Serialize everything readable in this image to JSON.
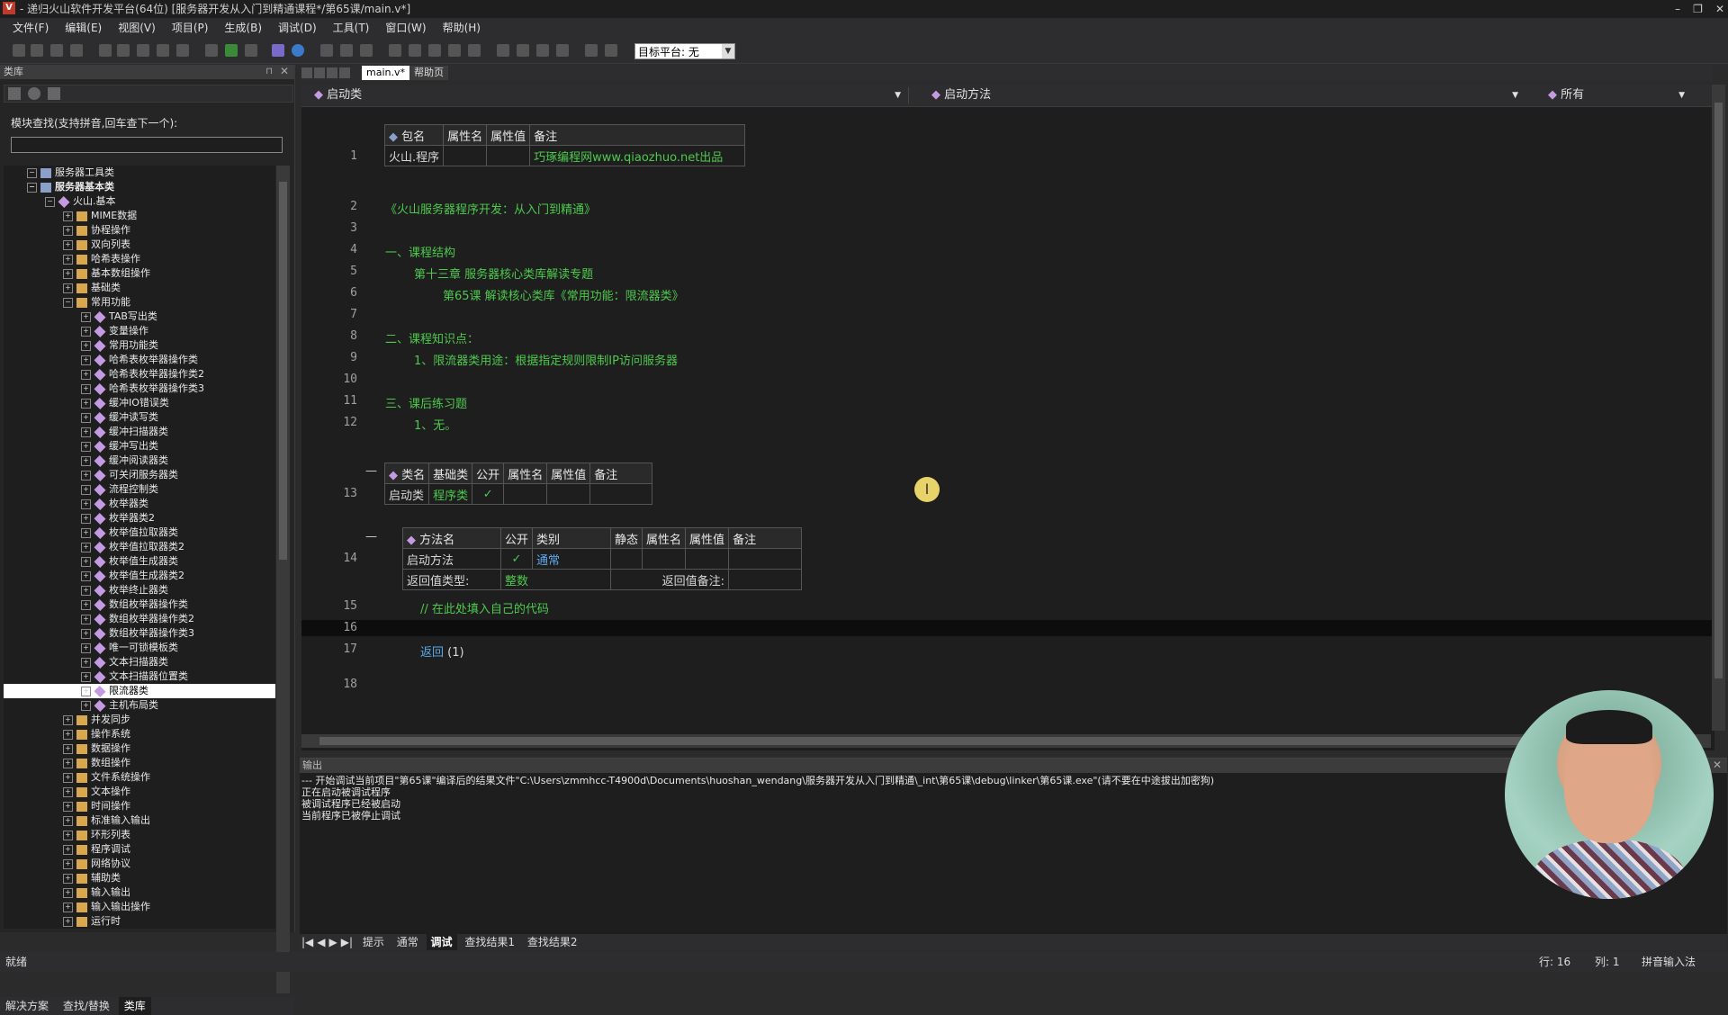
{
  "window": {
    "title": "- 递归火山软件开发平台(64位) [服务器开发从入门到精通课程*/第65课/main.v*]"
  },
  "menu": [
    "文件(F)",
    "编辑(E)",
    "视图(V)",
    "项目(P)",
    "生成(B)",
    "调试(D)",
    "工具(T)",
    "窗口(W)",
    "帮助(H)"
  ],
  "toolbar": {
    "target_label": "目标平台: 无"
  },
  "left_panel": {
    "title": "类库",
    "search_label": "模块查找(支持拼音,回车查下一个):",
    "search_value": "",
    "tree": [
      {
        "label": "服务器工具类",
        "level": 0,
        "type": "lib",
        "bold": false
      },
      {
        "label": "服务器基本类",
        "level": 0,
        "type": "lib",
        "bold": true
      },
      {
        "label": "火山.基本",
        "level": 1,
        "type": "class",
        "bold": false
      },
      {
        "label": "MIME数据",
        "level": 2,
        "type": "folder"
      },
      {
        "label": "协程操作",
        "level": 2,
        "type": "folder"
      },
      {
        "label": "双向列表",
        "level": 2,
        "type": "folder"
      },
      {
        "label": "哈希表操作",
        "level": 2,
        "type": "folder"
      },
      {
        "label": "基本数组操作",
        "level": 2,
        "type": "folder"
      },
      {
        "label": "基础类",
        "level": 2,
        "type": "folder"
      },
      {
        "label": "常用功能",
        "level": 2,
        "type": "folder"
      },
      {
        "label": "TAB写出类",
        "level": 3,
        "type": "class"
      },
      {
        "label": "变量操作",
        "level": 3,
        "type": "class"
      },
      {
        "label": "常用功能类",
        "level": 3,
        "type": "class"
      },
      {
        "label": "哈希表枚举器操作类",
        "level": 3,
        "type": "class"
      },
      {
        "label": "哈希表枚举器操作类2",
        "level": 3,
        "type": "class"
      },
      {
        "label": "哈希表枚举器操作类3",
        "level": 3,
        "type": "class"
      },
      {
        "label": "缓冲IO错误类",
        "level": 3,
        "type": "class"
      },
      {
        "label": "缓冲读写类",
        "level": 3,
        "type": "class"
      },
      {
        "label": "缓冲扫描器类",
        "level": 3,
        "type": "class"
      },
      {
        "label": "缓冲写出类",
        "level": 3,
        "type": "class"
      },
      {
        "label": "缓冲阅读器类",
        "level": 3,
        "type": "class"
      },
      {
        "label": "可关闭服务器类",
        "level": 3,
        "type": "class"
      },
      {
        "label": "流程控制类",
        "level": 3,
        "type": "class"
      },
      {
        "label": "枚举器类",
        "level": 3,
        "type": "class"
      },
      {
        "label": "枚举器类2",
        "level": 3,
        "type": "class"
      },
      {
        "label": "枚举值拉取器类",
        "level": 3,
        "type": "class"
      },
      {
        "label": "枚举值拉取器类2",
        "level": 3,
        "type": "class"
      },
      {
        "label": "枚举值生成器类",
        "level": 3,
        "type": "class"
      },
      {
        "label": "枚举值生成器类2",
        "level": 3,
        "type": "class"
      },
      {
        "label": "枚举终止器类",
        "level": 3,
        "type": "class"
      },
      {
        "label": "数组枚举器操作类",
        "level": 3,
        "type": "class"
      },
      {
        "label": "数组枚举器操作类2",
        "level": 3,
        "type": "class"
      },
      {
        "label": "数组枚举器操作类3",
        "level": 3,
        "type": "class"
      },
      {
        "label": "唯一可锁模板类",
        "level": 3,
        "type": "class"
      },
      {
        "label": "文本扫描器类",
        "level": 3,
        "type": "class"
      },
      {
        "label": "文本扫描器位置类",
        "level": 3,
        "type": "class"
      },
      {
        "label": "限流器类",
        "level": 3,
        "type": "class",
        "selected": true
      },
      {
        "label": "主机布局类",
        "level": 3,
        "type": "class"
      },
      {
        "label": "并发同步",
        "level": 2,
        "type": "folder"
      },
      {
        "label": "操作系统",
        "level": 2,
        "type": "folder"
      },
      {
        "label": "数据操作",
        "level": 2,
        "type": "folder"
      },
      {
        "label": "数组操作",
        "level": 2,
        "type": "folder"
      },
      {
        "label": "文件系统操作",
        "level": 2,
        "type": "folder"
      },
      {
        "label": "文本操作",
        "level": 2,
        "type": "folder"
      },
      {
        "label": "时间操作",
        "level": 2,
        "type": "folder"
      },
      {
        "label": "标准输入输出",
        "level": 2,
        "type": "folder"
      },
      {
        "label": "环形列表",
        "level": 2,
        "type": "folder"
      },
      {
        "label": "程序调试",
        "level": 2,
        "type": "folder"
      },
      {
        "label": "网络协议",
        "level": 2,
        "type": "folder"
      },
      {
        "label": "辅助类",
        "level": 2,
        "type": "folder"
      },
      {
        "label": "输入输出",
        "level": 2,
        "type": "folder"
      },
      {
        "label": "输入输出操作",
        "level": 2,
        "type": "folder"
      },
      {
        "label": "运行时",
        "level": 2,
        "type": "folder"
      }
    ],
    "bottom_tabs": [
      "解决方案",
      "查找/替换",
      "类库"
    ]
  },
  "editor": {
    "tabs": [
      "main.v*",
      "帮助页"
    ],
    "nav": {
      "class": "启动类",
      "method": "启动方法",
      "filter": "所有"
    },
    "pkg_table": {
      "headers": [
        "包名",
        "属性名",
        "属性值",
        "备注"
      ],
      "row": [
        "火山.程序",
        "",
        "",
        "巧琢编程网www.qiaozhuo.net出品"
      ]
    },
    "lines": {
      "l2": "《火山服务器程序开发：从入门到精通》",
      "l4": "一、课程结构",
      "l5": "第十三章 服务器核心类库解读专题",
      "l6": "第65课 解读核心类库《常用功能：限流器类》",
      "l8": "二、课程知识点：",
      "l9": "1、限流器类用途：根据指定规则限制IP访问服务器",
      "l11": "三、课后练习题",
      "l12": "1、无。",
      "l15": "// 在此处填入自己的代码",
      "l17_kw": "返回",
      "l17_arg": "(1)"
    },
    "line_numbers": [
      "1",
      "2",
      "3",
      "4",
      "5",
      "6",
      "7",
      "8",
      "9",
      "10",
      "11",
      "12",
      "13",
      "14",
      "15",
      "16",
      "17",
      "18"
    ],
    "class_table": {
      "headers": [
        "类名",
        "基础类",
        "公开",
        "属性名",
        "属性值",
        "备注"
      ],
      "row": [
        "启动类",
        "程序类",
        "✓",
        "",
        "",
        ""
      ]
    },
    "method_table": {
      "headers": [
        "方法名",
        "公开",
        "类别",
        "静态",
        "属性名",
        "属性值",
        "备注"
      ],
      "row": [
        "启动方法",
        "✓",
        "通常",
        "",
        "",
        "",
        ""
      ],
      "ret_type_label": "返回值类型:",
      "ret_type": "整数",
      "ret_note_label": "返回值备注:"
    }
  },
  "output": {
    "title": "输出",
    "lines": [
      "--- 开始调试当前项目\"第65课\"编译后的结果文件\"C:\\Users\\zmmhcc-T4900d\\Documents\\huoshan_wendang\\服务器开发从入门到精通\\_int\\第65课\\debug\\linker\\第65课.exe\"(请不要在中途拔出加密狗)",
      "正在启动被调试程序",
      "被调试程序已经被启动",
      "当前程序已被停止调试"
    ],
    "tabs": [
      "提示",
      "通常",
      "调试",
      "查找结果1",
      "查找结果2"
    ]
  },
  "status": {
    "left": "就绪",
    "row": "行: 16",
    "col": "列: 1",
    "ime": "拼音输入法"
  }
}
